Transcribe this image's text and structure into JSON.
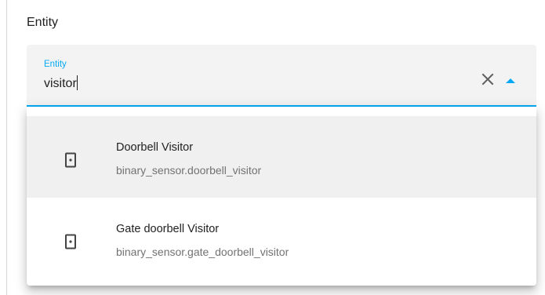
{
  "section": {
    "title": "Entity"
  },
  "entity_field": {
    "label": "Entity",
    "value": "visitor",
    "clear_icon": "close-icon",
    "toggle_icon": "menu-up-icon",
    "accent_color": "#03a9f4"
  },
  "options": [
    {
      "name": "Doorbell Visitor",
      "entity_id": "binary_sensor.doorbell_visitor",
      "icon": "door-sensor-icon",
      "highlighted": true
    },
    {
      "name": "Gate doorbell Visitor",
      "entity_id": "binary_sensor.gate_doorbell_visitor",
      "icon": "door-sensor-icon",
      "highlighted": false
    }
  ]
}
